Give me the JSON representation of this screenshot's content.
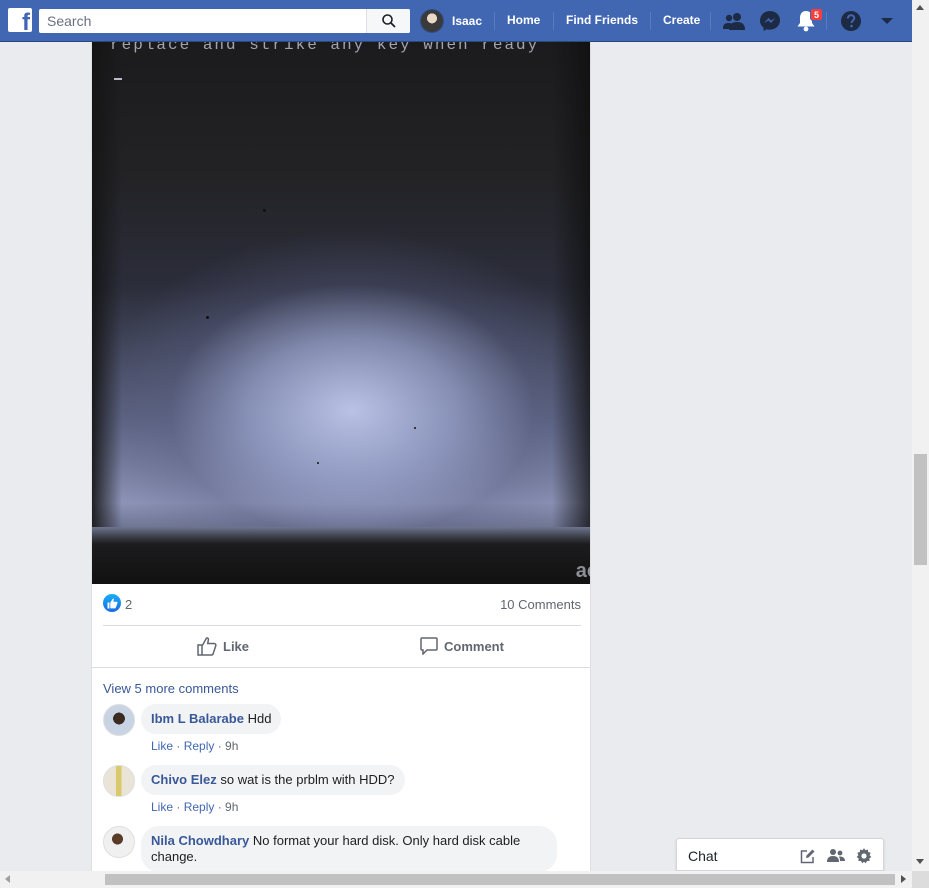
{
  "topbar": {
    "search_placeholder": "Search",
    "user_name": "Isaac",
    "home_label": "Home",
    "find_friends_label": "Find Friends",
    "create_label": "Create",
    "notification_count": "5",
    "accent_color": "#4267b2"
  },
  "post": {
    "screen_text": "replace and strike any key when ready",
    "brand_text": "ac",
    "like_count": "2",
    "comments_count": "10 Comments",
    "like_label": "Like",
    "comment_label": "Comment",
    "view_more": "View 5 more comments",
    "comments": [
      {
        "author": "Ibm L Balarabe",
        "text": "Hdd",
        "like": "Like",
        "reply": "Reply",
        "time": "9h"
      },
      {
        "author": "Chivo Elez",
        "text": "so wat is the prblm with HDD?",
        "like": "Like",
        "reply": "Reply",
        "time": "9h"
      },
      {
        "author": "Nila Chowdhary",
        "text": "No format your hard disk. Only hard disk cable change."
      }
    ]
  },
  "chat": {
    "label": "Chat"
  },
  "icons": [
    "facebook-logo-icon",
    "search-icon",
    "friends-icon",
    "messenger-icon",
    "bell-icon",
    "help-icon",
    "caret-down-icon",
    "thumbs-up-icon",
    "comment-icon",
    "compose-icon",
    "group-icon",
    "gear-icon"
  ]
}
